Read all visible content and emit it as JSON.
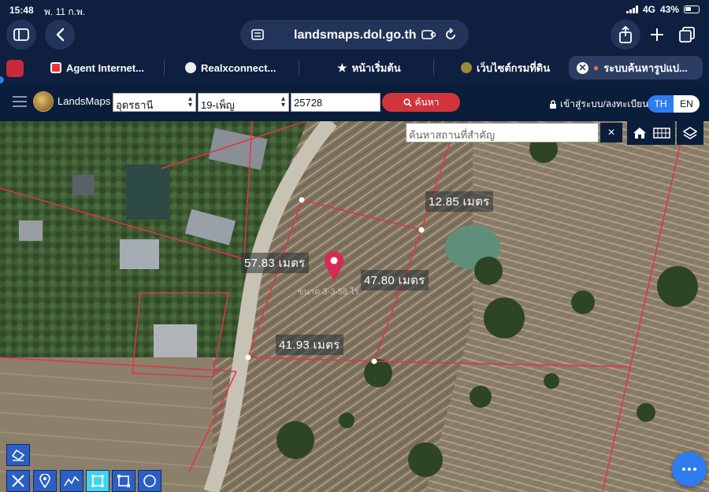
{
  "status_bar": {
    "time": "15:48",
    "date": "พ. 11 ก.พ.",
    "network": "4G",
    "battery": "43%"
  },
  "browser": {
    "url": "landsmaps.dol.go.th",
    "tabs": [
      {
        "label": "Agent Internet..."
      },
      {
        "label": "Realxconnect..."
      },
      {
        "label": "หน้าเริ่มต้น"
      },
      {
        "label": "เว็บไซต์กรมที่ดิน"
      },
      {
        "label": "ระบบค้นหารูปแป..."
      }
    ]
  },
  "toolbar": {
    "app_name": "LandsMaps",
    "province": "อุดรธานี",
    "district": "19-เพ็ญ",
    "parcel_number": "25728",
    "search_label": "ค้นหา",
    "login_label": "เข้าสู่ระบบ/ลงทะเบียน",
    "lang_th": "TH",
    "lang_en": "EN"
  },
  "map": {
    "place_search_placeholder": "ค้นหาสถานที่สำคัญ",
    "clear_symbol": "×",
    "parcel_label": "ขนาด 3-3-58 ไร่",
    "measurements": {
      "left_edge": "57.83 เมตร",
      "top_edge": "12.85 เมตร",
      "right_edge": "47.80 เมตร",
      "bottom_edge": "41.93 เมตร"
    },
    "parcel_line_color": "#e0334a",
    "pin_color": "#d62a56"
  },
  "drawing_tools": [
    "eraser-icon",
    "measure-line-icon",
    "marker-icon",
    "polyline-icon",
    "polygon-icon",
    "rectangle-icon",
    "circle-icon"
  ]
}
